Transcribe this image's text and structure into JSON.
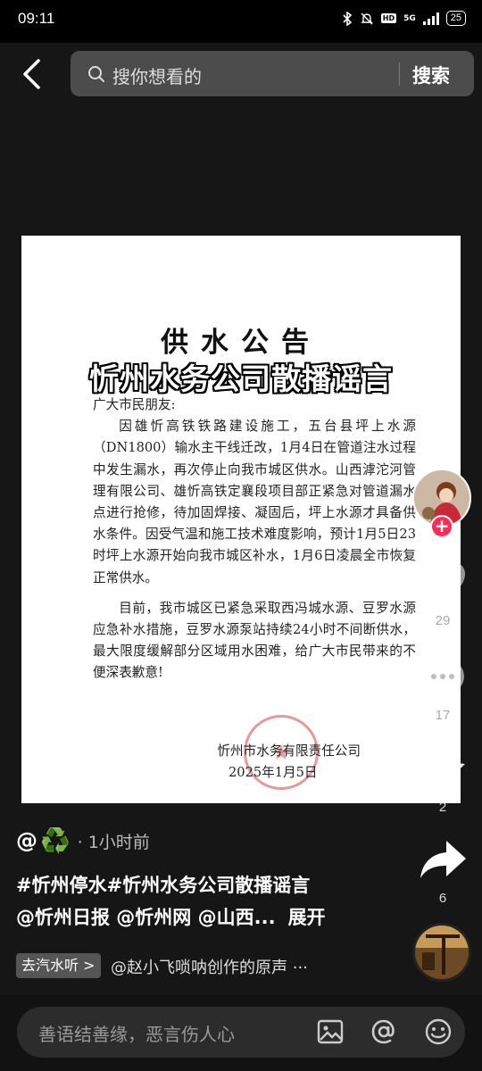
{
  "status_bar": {
    "time": "09:11",
    "network": "5G",
    "battery": "25",
    "hd_label": "HD"
  },
  "search": {
    "placeholder": "搜你想看的",
    "button_label": "搜索"
  },
  "notice": {
    "title": "供水公告",
    "greeting": "广大市民朋友:",
    "paragraph_1": "因雄忻高铁铁路建设施工，五台县坪上水源（DN1800）输水主干线迁改，1月4日在管道注水过程中发生漏水，再次停止向我市城区供水。山西滹沱河管理有限公司、雄忻高铁定襄段项目部正紧急对管道漏水点进行抢修，待加固焊接、凝固后，坪上水源才具备供水条件。因受气温和施工技术难度影响，预计1月5日23时坪上水源开始向我市城区补水，1月6日凌晨全市恢复正常供水。",
    "paragraph_2": "目前，我市城区已紧急采取西冯城水源、豆罗水源应急补水措施，豆罗水源泵站持续24小时不间断供水，最大限度缓解部分区域用水困难，给广大市民带来的不便深表歉意!",
    "signature": "忻州市水务有限责任公司",
    "date": "2025年1月5日"
  },
  "overlay_caption": "忻州水务公司散播谣言",
  "actions": {
    "like_count": "29",
    "comment_count": "17",
    "favorite_count": "2",
    "share_count": "6"
  },
  "post": {
    "author_prefix": "@",
    "author_emoji": "♻️",
    "time_text": "· 1小时前",
    "description_line1": "#忻州停水#忻州水务公司散播谣言",
    "description_line2": "@忻州日报 @忻州网 @山西...",
    "expand_label": "展开",
    "music_tag": "去汽水听 >",
    "music_text": "@赵小飞唢呐创作的原声 ···"
  },
  "comment_bar": {
    "placeholder": "善语结善缘，恶言伤人心"
  },
  "colors": {
    "accent": "#fe2c55",
    "search_bg": "#4c4c4c",
    "background": "#161616"
  }
}
